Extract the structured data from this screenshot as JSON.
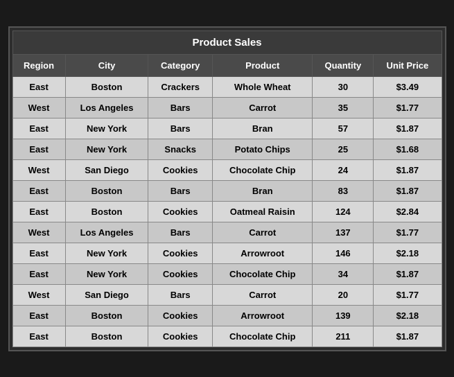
{
  "table": {
    "title": "Product Sales",
    "headers": [
      "Region",
      "City",
      "Category",
      "Product",
      "Quantity",
      "Unit Price"
    ],
    "rows": [
      [
        "East",
        "Boston",
        "Crackers",
        "Whole Wheat",
        "30",
        "$3.49"
      ],
      [
        "West",
        "Los Angeles",
        "Bars",
        "Carrot",
        "35",
        "$1.77"
      ],
      [
        "East",
        "New York",
        "Bars",
        "Bran",
        "57",
        "$1.87"
      ],
      [
        "East",
        "New York",
        "Snacks",
        "Potato Chips",
        "25",
        "$1.68"
      ],
      [
        "West",
        "San Diego",
        "Cookies",
        "Chocolate Chip",
        "24",
        "$1.87"
      ],
      [
        "East",
        "Boston",
        "Bars",
        "Bran",
        "83",
        "$1.87"
      ],
      [
        "East",
        "Boston",
        "Cookies",
        "Oatmeal Raisin",
        "124",
        "$2.84"
      ],
      [
        "West",
        "Los Angeles",
        "Bars",
        "Carrot",
        "137",
        "$1.77"
      ],
      [
        "East",
        "New York",
        "Cookies",
        "Arrowroot",
        "146",
        "$2.18"
      ],
      [
        "East",
        "New York",
        "Cookies",
        "Chocolate Chip",
        "34",
        "$1.87"
      ],
      [
        "West",
        "San Diego",
        "Bars",
        "Carrot",
        "20",
        "$1.77"
      ],
      [
        "East",
        "Boston",
        "Cookies",
        "Arrowroot",
        "139",
        "$2.18"
      ],
      [
        "East",
        "Boston",
        "Cookies",
        "Chocolate Chip",
        "211",
        "$1.87"
      ]
    ]
  }
}
